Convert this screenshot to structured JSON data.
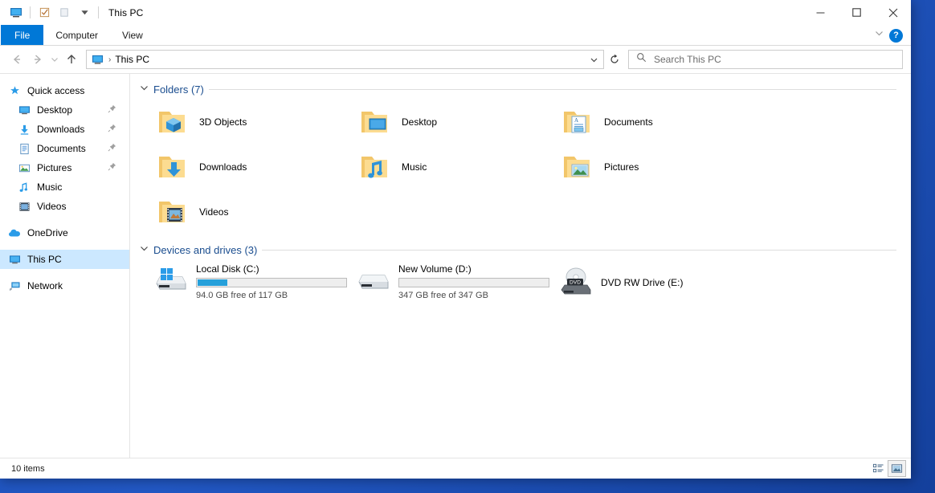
{
  "window": {
    "title": "This PC",
    "quick_access_toolbar": [
      {
        "name": "this-pc-icon",
        "label": "This PC"
      },
      {
        "name": "properties-icon",
        "label": "Properties"
      },
      {
        "name": "new-folder-icon",
        "label": "New folder"
      },
      {
        "name": "customize-quick-access-chevron",
        "label": "Customize Quick Access Toolbar"
      }
    ],
    "controls": {
      "minimize": "─",
      "maximize": "☐",
      "close": "✕"
    }
  },
  "ribbon": {
    "tabs": [
      {
        "label": "File",
        "active": true
      },
      {
        "label": "Computer",
        "active": false
      },
      {
        "label": "View",
        "active": false
      }
    ],
    "collapse_chevron": "⌄",
    "help_label": "?"
  },
  "address": {
    "back": "←",
    "forward": "→",
    "recent": "⌄",
    "up": "↑",
    "breadcrumb_icon": "this-pc-icon",
    "breadcrumb_separator": "›",
    "breadcrumb_text": "This PC",
    "history_chevron": "⌄",
    "refresh": "↻"
  },
  "search": {
    "placeholder": "Search This PC",
    "value": ""
  },
  "sidebar": {
    "items": [
      {
        "label": "Quick access",
        "icon": "star-pin-icon",
        "indent": "root",
        "pinned": false,
        "selected": false
      },
      {
        "label": "Desktop",
        "icon": "desktop-icon",
        "indent": "child",
        "pinned": true,
        "selected": false
      },
      {
        "label": "Downloads",
        "icon": "downloads-icon",
        "indent": "child",
        "pinned": true,
        "selected": false
      },
      {
        "label": "Documents",
        "icon": "documents-icon",
        "indent": "child",
        "pinned": true,
        "selected": false
      },
      {
        "label": "Pictures",
        "icon": "pictures-icon",
        "indent": "child",
        "pinned": true,
        "selected": false
      },
      {
        "label": "Music",
        "icon": "music-icon",
        "indent": "child",
        "pinned": false,
        "selected": false
      },
      {
        "label": "Videos",
        "icon": "videos-icon",
        "indent": "child",
        "pinned": false,
        "selected": false
      },
      {
        "label": "OneDrive",
        "icon": "onedrive-icon",
        "indent": "root",
        "pinned": false,
        "selected": false
      },
      {
        "label": "This PC",
        "icon": "this-pc-icon",
        "indent": "root",
        "pinned": false,
        "selected": true
      },
      {
        "label": "Network",
        "icon": "network-icon",
        "indent": "root",
        "pinned": false,
        "selected": false
      }
    ],
    "pin_glyph": "❯"
  },
  "main": {
    "groups": [
      {
        "title": "Folders (7)",
        "chevron": "⌄",
        "items": [
          {
            "label": "3D Objects",
            "icon": "folder-3d-objects-icon"
          },
          {
            "label": "Desktop",
            "icon": "folder-desktop-icon"
          },
          {
            "label": "Documents",
            "icon": "folder-documents-icon"
          },
          {
            "label": "Downloads",
            "icon": "folder-downloads-icon"
          },
          {
            "label": "Music",
            "icon": "folder-music-icon"
          },
          {
            "label": "Pictures",
            "icon": "folder-pictures-icon"
          },
          {
            "label": "Videos",
            "icon": "folder-videos-icon"
          }
        ]
      }
    ],
    "drives_group": {
      "title": "Devices and drives (3)",
      "chevron": "⌄",
      "drives": [
        {
          "name": "Local Disk (C:)",
          "icon": "hard-drive-windows-icon",
          "free_text": "94.0 GB free of 117 GB",
          "used_percent": 20,
          "has_bar": true
        },
        {
          "name": "New Volume (D:)",
          "icon": "hard-drive-icon",
          "free_text": "347 GB free of 347 GB",
          "used_percent": 0,
          "has_bar": true
        },
        {
          "name": "DVD RW Drive (E:)",
          "icon": "dvd-drive-icon",
          "free_text": "",
          "used_percent": 0,
          "has_bar": false
        }
      ]
    }
  },
  "statusbar": {
    "item_count": "10 items",
    "views": [
      {
        "name": "details-view-button",
        "active": false
      },
      {
        "name": "large-icons-view-button",
        "active": true
      }
    ]
  },
  "colors": {
    "accent": "#0078d7",
    "group_title": "#1a4d8f",
    "selection": "#cce8ff",
    "drive_bar": "#26a0da",
    "desktop": "#1c4fb5"
  }
}
